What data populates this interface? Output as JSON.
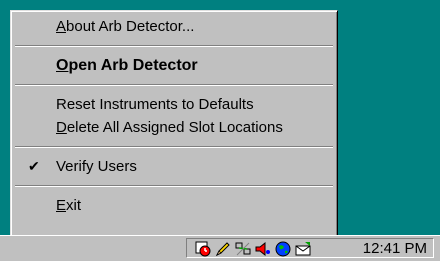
{
  "menu": {
    "about": {
      "mnemonic": "A",
      "rest": "bout Arb Detector..."
    },
    "open": {
      "mnemonic": "O",
      "rest": "pen Arb Detector"
    },
    "reset": {
      "label": "Reset Instruments to Defaults"
    },
    "delete": {
      "mnemonic": "D",
      "rest": "elete All Assigned Slot Locations"
    },
    "verify": {
      "label": "Verify Users",
      "checked": true,
      "check_glyph": "✔"
    },
    "exit": {
      "mnemonic": "E",
      "rest": "xit"
    }
  },
  "taskbar": {
    "clock": "12:41 PM",
    "tray_icons": [
      "alarm-clock-icon",
      "pencil-icon",
      "network-icon",
      "speaker-icon",
      "globe-icon",
      "mail-icon"
    ]
  },
  "colors": {
    "desktop": "#008080",
    "menu_face": "#c0c0c0"
  }
}
